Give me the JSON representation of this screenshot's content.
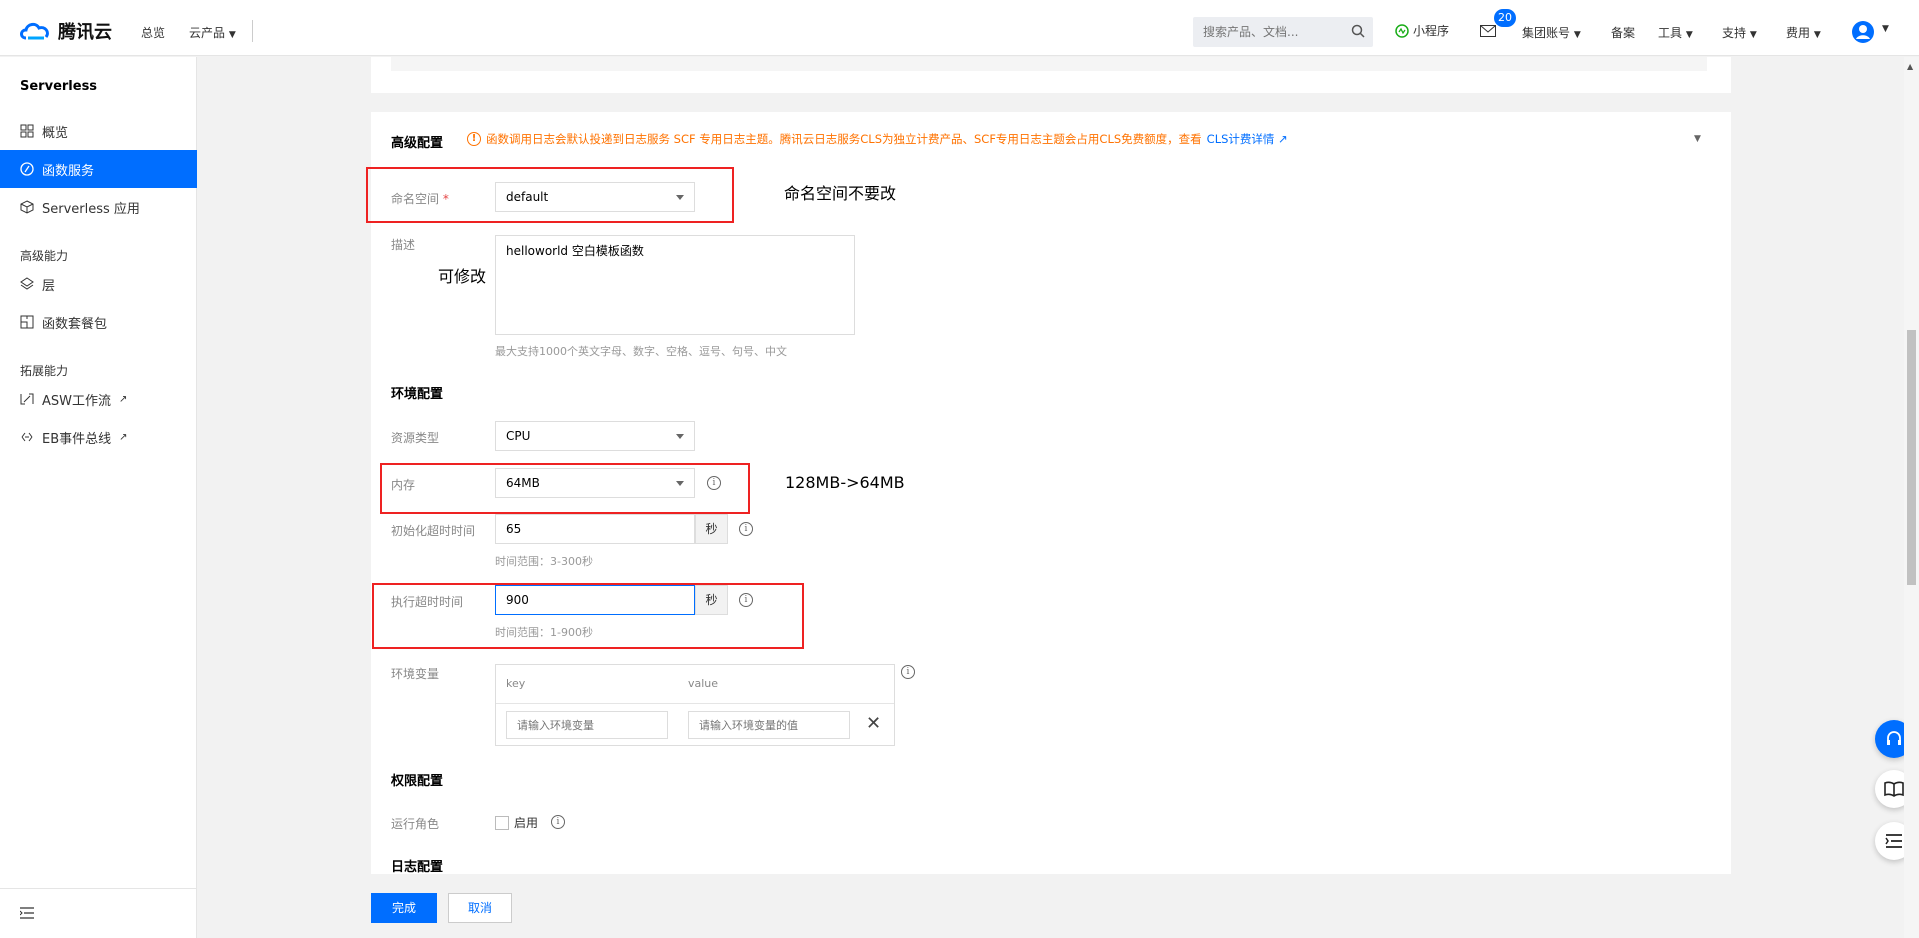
{
  "topbar": {
    "brand": "腾讯云",
    "overview": "总览",
    "products": "云产品",
    "search_placeholder": "搜索产品、文档...",
    "mini_program": "小程序",
    "message_count": "20",
    "group_account": "集团账号",
    "filing": "备案",
    "tools": "工具",
    "support": "支持",
    "billing": "费用"
  },
  "sidebar": {
    "title": "Serverless",
    "items": [
      {
        "label": "概览"
      },
      {
        "label": "函数服务"
      },
      {
        "label": "Serverless 应用"
      }
    ],
    "group_advanced": "高级能力",
    "advanced_items": [
      {
        "label": "层"
      },
      {
        "label": "函数套餐包"
      }
    ],
    "group_extend": "拓展能力",
    "extend_items": [
      {
        "label": "ASW工作流"
      },
      {
        "label": "EB事件总线"
      }
    ]
  },
  "advanced": {
    "title": "高级配置",
    "notice_text": "函数调用日志会默认投递到日志服务 SCF 专用日志主题。腾讯云日志服务CLS为独立计费产品、SCF专用日志主题会占用CLS免费额度，查看",
    "notice_link": "CLS计费详情",
    "namespace_label": "命名空间",
    "namespace_required": "*",
    "namespace_value": "default",
    "description_label": "描述",
    "description_value": "helloworld 空白模板函数",
    "description_hint": "最大支持1000个英文字母、数字、空格、逗号、句号、中文"
  },
  "env": {
    "title": "环境配置",
    "resource_label": "资源类型",
    "resource_value": "CPU",
    "memory_label": "内存",
    "memory_value": "64MB",
    "init_timeout_label": "初始化超时时间",
    "init_timeout_value": "65",
    "init_timeout_unit": "秒",
    "init_timeout_hint": "时间范围：3-300秒",
    "exec_timeout_label": "执行超时时间",
    "exec_timeout_value": "900",
    "exec_timeout_unit": "秒",
    "exec_timeout_hint": "时间范围：1-900秒",
    "envvar_label": "环境变量",
    "envvar_key_header": "key",
    "envvar_value_header": "value",
    "envvar_key_placeholder": "请输入环境变量",
    "envvar_value_placeholder": "请输入环境变量的值"
  },
  "permission": {
    "title": "权限配置",
    "role_label": "运行角色",
    "enable_label": "启用"
  },
  "log": {
    "title": "日志配置"
  },
  "annotations": {
    "namespace_note": "命名空间不要改",
    "description_note": "可修改",
    "memory_note": "128MB->64MB"
  },
  "footer": {
    "confirm": "完成",
    "cancel": "取消"
  },
  "colors": {
    "primary": "#006eff",
    "warning": "#ff7200",
    "highlight_box": "#e22222"
  }
}
